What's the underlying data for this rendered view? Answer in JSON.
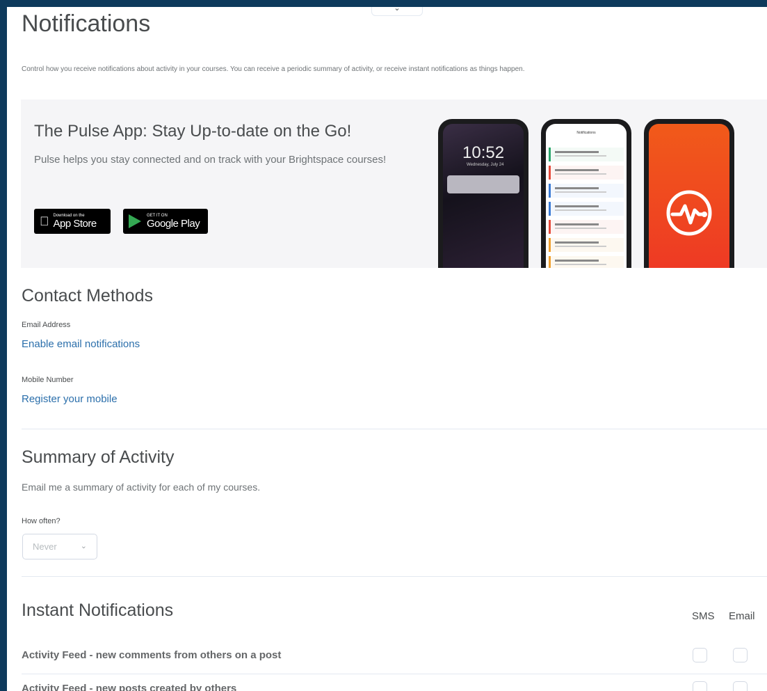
{
  "page": {
    "title": "Notifications",
    "description": "Control how you receive notifications about activity in your courses. You can receive a periodic summary of activity, or receive instant notifications as things happen."
  },
  "pulse": {
    "title": "The Pulse App: Stay Up-to-date on the Go!",
    "body": "Pulse helps you stay connected and on track with your Brightspace courses!",
    "app_store": {
      "small": "Download on the",
      "big": "App Store"
    },
    "google_play": {
      "small": "GET IT ON",
      "big": "Google Play"
    },
    "phone_lock_time": "10:52",
    "phone_lock_date": "Wednesday, July 24",
    "phone_app_header": "Notifications"
  },
  "contact": {
    "heading": "Contact Methods",
    "email_label": "Email Address",
    "email_link": "Enable email notifications",
    "mobile_label": "Mobile Number",
    "mobile_link": "Register your mobile"
  },
  "summary": {
    "heading": "Summary of Activity",
    "text": "Email me a summary of activity for each of my courses.",
    "how_often_label": "How often?",
    "frequency_value": "Never"
  },
  "instant": {
    "heading": "Instant Notifications",
    "col_sms": "SMS",
    "col_email": "Email",
    "rows": [
      {
        "label": "Activity Feed - new comments from others on a post",
        "sms": false,
        "email": false
      },
      {
        "label": "Activity Feed - new posts created by others",
        "sms": false,
        "email": false
      }
    ]
  },
  "colors": {
    "frame": "#0e3a5c",
    "link": "#2b6fab",
    "pulse_orange": "#f15a1a",
    "panel": "#f5f5f7"
  }
}
